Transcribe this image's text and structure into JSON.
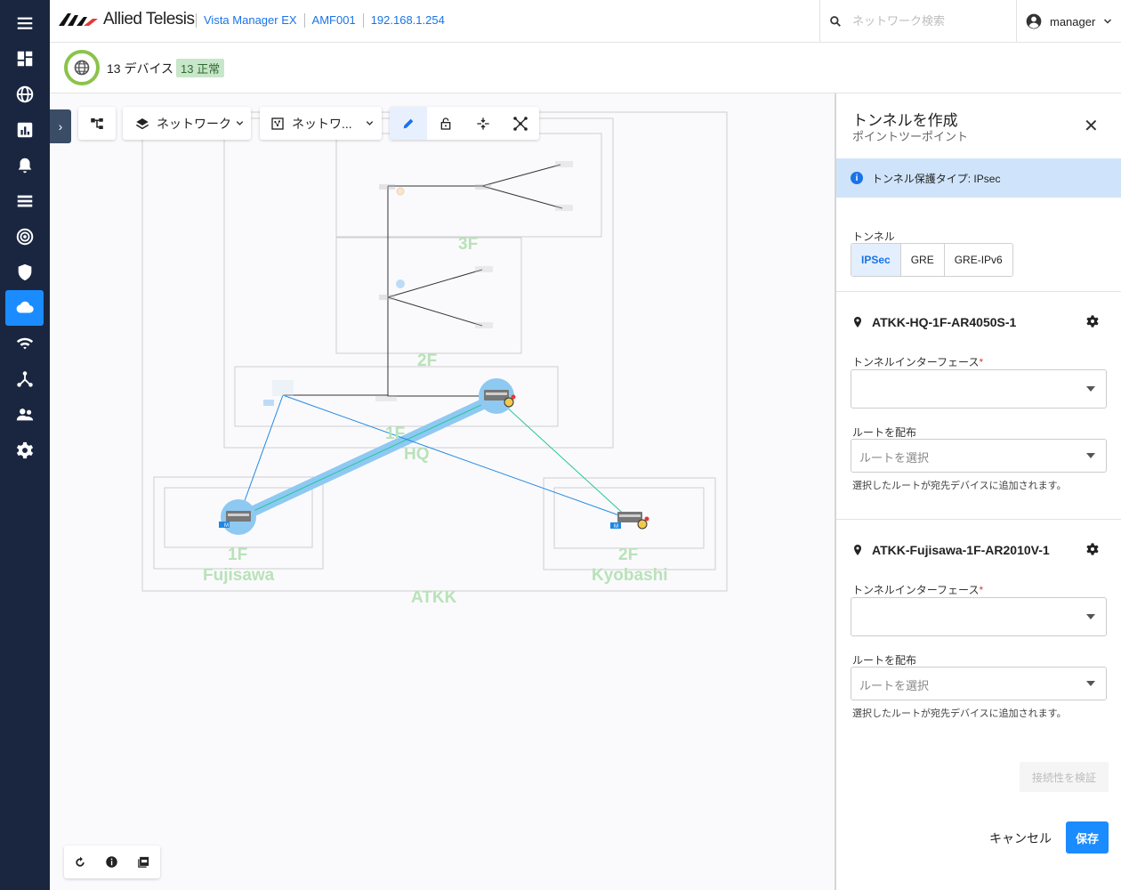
{
  "brand": {
    "logo_text": "Allied Telesis"
  },
  "breadcrumbs": [
    "Vista Manager EX",
    "AMF001",
    "192.168.1.254"
  ],
  "search": {
    "placeholder": "ネットワーク検索"
  },
  "user": {
    "name": "manager"
  },
  "status": {
    "device_count": "13 デバイス",
    "normal_badge": "13 正常"
  },
  "toolbar": {
    "network_dropdown": "ネットワーク",
    "network_view_dropdown": "ネットワ..."
  },
  "map": {
    "group_labels": [
      "3F",
      "2F",
      "1F",
      "HQ",
      "1F",
      "Fujisawa",
      "2F",
      "Kyobashi",
      "ATKK"
    ],
    "device_badge": "M",
    "link_colors": {
      "ipsec": "#8ec9f2",
      "blue": "#1e88e5",
      "green": "#26c6a0",
      "wired": "#333333"
    }
  },
  "panel": {
    "title": "トンネルを作成",
    "subtitle": "ポイントツーポイント",
    "info": "トンネル保護タイプ: IPsec",
    "tunnel_label": "トンネル",
    "tunnel_options": [
      "IPSec",
      "GRE",
      "GRE-IPv6"
    ],
    "tunnel_selected": "IPSec",
    "endpoints": [
      {
        "device": "ATKK-HQ-1F-AR4050S-1",
        "iface_label": "トンネルインターフェース",
        "required_mark": "*",
        "route_label": "ルートを配布",
        "route_placeholder": "ルートを選択",
        "route_help": "選択したルートが宛先デバイスに追加されます。"
      },
      {
        "device": "ATKK-Fujisawa-1F-AR2010V-1",
        "iface_label": "トンネルインターフェース",
        "required_mark": "*",
        "route_label": "ルートを配布",
        "route_placeholder": "ルートを選択",
        "route_help": "選択したルートが宛先デバイスに追加されます。"
      }
    ],
    "verify_button": "接続性を検証",
    "cancel_button": "キャンセル",
    "save_button": "保存"
  }
}
